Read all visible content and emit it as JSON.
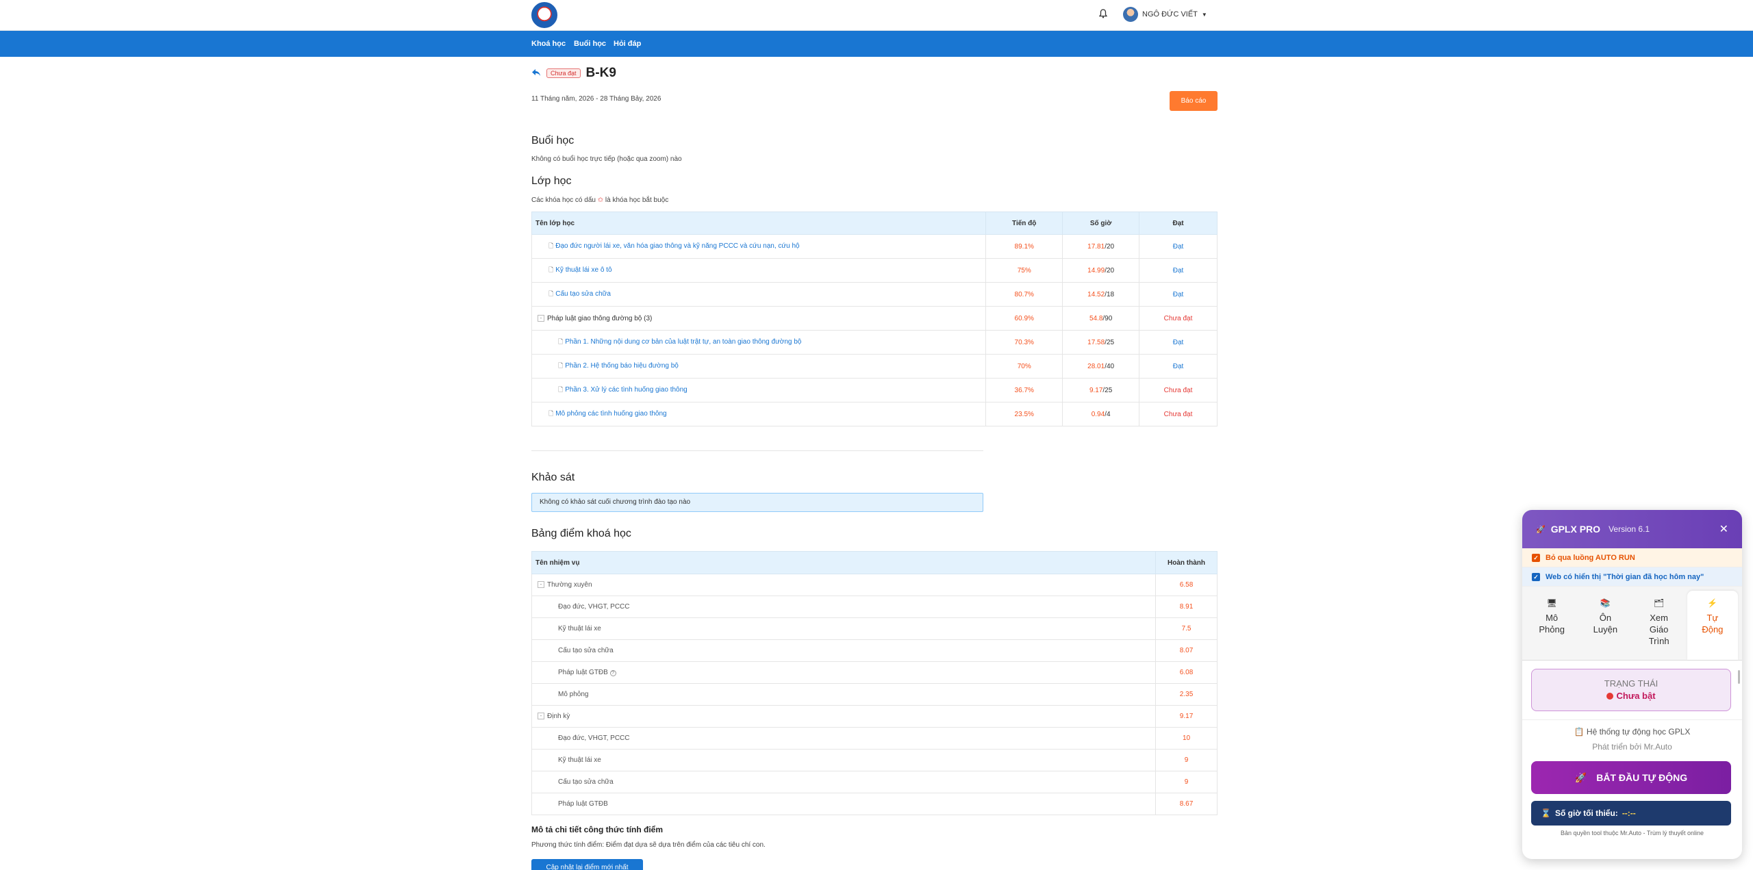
{
  "header": {
    "user_name": "NGÔ ĐỨC VIẾT"
  },
  "nav": {
    "items": [
      "Khoá học",
      "Buổi học",
      "Hỏi đáp"
    ]
  },
  "course": {
    "badge": "Chưa đạt",
    "title": "B-K9",
    "dates": "11 Tháng năm, 2026 - 28 Tháng Bảy, 2026",
    "report_label": "Báo cáo"
  },
  "sessions": {
    "heading": "Buổi học",
    "note": "Không có buổi học trực tiếp (hoặc qua zoom) nào"
  },
  "classes": {
    "heading": "Lớp học",
    "note_before": "Các khóa học có dấu",
    "note_star": "✩",
    "note_after": "là khóa học bắt buộc",
    "columns": [
      "Tên lớp học",
      "Tiến độ",
      "Số giờ",
      "Đạt"
    ],
    "rows": [
      {
        "name": "Đạo đức người lái xe, văn hóa giao thông và kỹ năng PCCC và cứu nạn, cứu hộ",
        "progress": "89.1%",
        "hours": "17.81",
        "total": "/20",
        "status": "Đạt",
        "pass": true,
        "level": 1,
        "group": false
      },
      {
        "name": "Kỹ thuật lái xe ô tô",
        "progress": "75%",
        "hours": "14.99",
        "total": "/20",
        "status": "Đạt",
        "pass": true,
        "level": 1,
        "group": false
      },
      {
        "name": "Cấu tạo sửa chữa",
        "progress": "80.7%",
        "hours": "14.52",
        "total": "/18",
        "status": "Đạt",
        "pass": true,
        "level": 1,
        "group": false
      },
      {
        "name": "Pháp luật giao thông đường bộ",
        "count": "(3)",
        "progress": "60.9%",
        "hours": "54.8",
        "total": "/90",
        "status": "Chưa đạt",
        "pass": false,
        "level": 0,
        "group": true
      },
      {
        "name": "Phần 1. Những nội dung cơ bản của luật trật tự, an toàn giao thông đường bộ",
        "progress": "70.3%",
        "hours": "17.58",
        "total": "/25",
        "status": "Đạt",
        "pass": true,
        "level": 2,
        "group": false
      },
      {
        "name": "Phần 2. Hệ thống báo hiệu đường bộ",
        "progress": "70%",
        "hours": "28.01",
        "total": "/40",
        "status": "Đạt",
        "pass": true,
        "level": 2,
        "group": false
      },
      {
        "name": "Phần 3. Xử lý các tình huống giao thông",
        "progress": "36.7%",
        "hours": "9.17",
        "total": "/25",
        "status": "Chưa đạt",
        "pass": false,
        "level": 2,
        "group": false
      },
      {
        "name": "Mô phỏng các tình huống giao thông",
        "progress": "23.5%",
        "hours": "0.94",
        "total": "/4",
        "status": "Chưa đạt",
        "pass": false,
        "level": 1,
        "group": false
      }
    ]
  },
  "survey": {
    "heading": "Khảo sát",
    "note": "Không có khảo sát cuối chương trình đào tạo nào"
  },
  "grades": {
    "heading": "Bảng điểm khoá học",
    "columns": [
      "Tên nhiệm vụ",
      "Hoàn thành"
    ],
    "rows": [
      {
        "name": "Thường xuyên",
        "value": "6.58",
        "group": true,
        "info": false
      },
      {
        "name": "Đạo đức, VHGT, PCCC",
        "value": "8.91",
        "group": false,
        "info": false
      },
      {
        "name": "Kỹ thuật lái xe",
        "value": "7.5",
        "group": false,
        "info": false
      },
      {
        "name": "Cấu tạo sửa chữa",
        "value": "8.07",
        "group": false,
        "info": false
      },
      {
        "name": "Pháp luật GTĐB",
        "value": "6.08",
        "group": false,
        "info": true
      },
      {
        "name": "Mô phỏng",
        "value": "2.35",
        "group": false,
        "info": false
      },
      {
        "name": "Định kỳ",
        "value": "9.17",
        "group": true,
        "info": false
      },
      {
        "name": "Đạo đức, VHGT, PCCC",
        "value": "10",
        "group": false,
        "info": false
      },
      {
        "name": "Kỹ thuật lái xe",
        "value": "9",
        "group": false,
        "info": false
      },
      {
        "name": "Cấu tạo sửa chữa",
        "value": "9",
        "group": false,
        "info": false
      },
      {
        "name": "Pháp luật GTĐB",
        "value": "8.67",
        "group": false,
        "info": false
      }
    ],
    "formula_title": "Mô tả chi tiết công thức tính điểm",
    "formula_text": "Phương thức tính điểm: Điểm đạt dựa sẽ dựa trên điểm của các tiêu chí con.",
    "update_label": "Cập nhật lại điểm mới nhất"
  },
  "widget": {
    "title": "GPLX PRO",
    "version": "Version 6.1",
    "option1": "Bỏ qua luồng AUTO RUN",
    "option2": "Web có hiển thị \"Thời gian đã học hôm nay\"",
    "tabs": [
      {
        "label_1": "Mô",
        "label_2": "Phỏng",
        "label_3": "",
        "icon": "monitor-icon",
        "active": false
      },
      {
        "label_1": "Ôn",
        "label_2": "Luyện",
        "label_3": "",
        "icon": "book-icon",
        "active": false
      },
      {
        "label_1": "Xem",
        "label_2": "Giáo",
        "label_3": "Trình",
        "icon": "board-icon",
        "active": false
      },
      {
        "label_1": "Tự",
        "label_2": "Động",
        "label_3": "",
        "icon": "lightning-icon",
        "active": true
      }
    ],
    "status_label": "TRẠNG THÁI",
    "status_value": "Chưa bật",
    "system_title": "Hệ thống tự động học GPLX",
    "system_sub": "Phát triển bởi Mr.Auto",
    "start_label": "BẮT ĐẦU TỰ ĐỘNG",
    "min_hours_label": "Số giờ tối thiểu:",
    "min_hours_value": "--:--",
    "copyright": "Bản quyền tool thuộc Mr.Auto - Trùm lý thuyết online"
  }
}
